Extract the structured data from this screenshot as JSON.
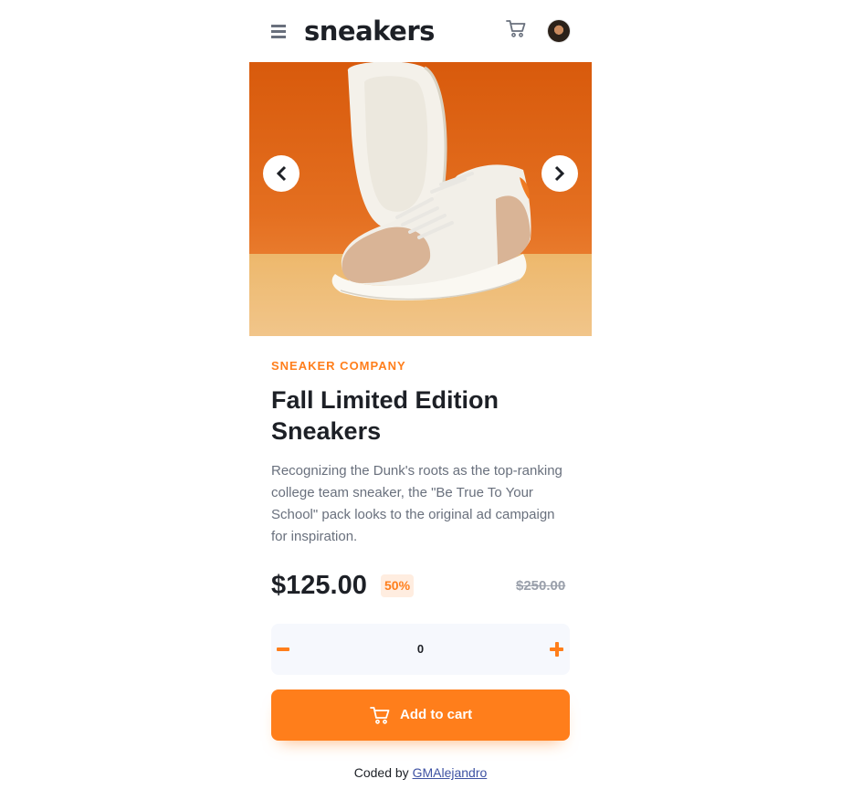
{
  "header": {
    "logo": "sneakers",
    "menu_icon": "menu-icon",
    "cart_icon": "cart-icon",
    "avatar_icon": "avatar"
  },
  "gallery": {
    "prev_icon": "chevron-left-icon",
    "next_icon": "chevron-right-icon"
  },
  "product": {
    "company": "SNEAKER COMPANY",
    "title": "Fall Limited Edition Sneakers",
    "description": "Recognizing the Dunk's roots as the top-ranking college team sneaker, the \"Be True To Your School\" pack looks to the original ad campaign for inspiration.",
    "price": "$125.00",
    "discount": "50%",
    "original_price": "$250.00"
  },
  "quantity": {
    "value": "0",
    "minus_icon": "minus-icon",
    "plus_icon": "plus-icon"
  },
  "cart_button": {
    "label": "Add to cart",
    "icon": "cart-icon"
  },
  "footer": {
    "prefix": "Coded by",
    "author": "GMAlejandro"
  },
  "colors": {
    "accent": "#ff7e1b",
    "accent_pale": "#ffede0",
    "text_dark": "#1d2026",
    "text_muted": "#69707d",
    "qty_background": "#f6f8fd"
  }
}
